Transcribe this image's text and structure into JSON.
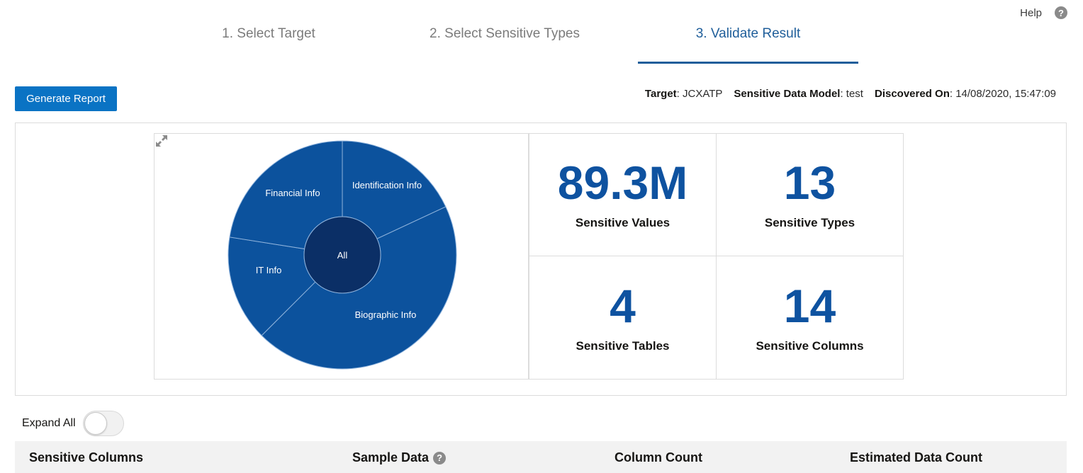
{
  "help": {
    "label": "Help",
    "icon": "help-icon"
  },
  "train": {
    "steps": [
      {
        "label": "1. Select Target",
        "active": false
      },
      {
        "label": "2. Select Sensitive Types",
        "active": false
      },
      {
        "label": "3. Validate Result",
        "active": true
      }
    ]
  },
  "toolbar": {
    "generate_report": "Generate Report"
  },
  "meta": {
    "target_label": "Target",
    "target_value": "JCXATP",
    "model_label": "Sensitive Data Model",
    "model_value": "test",
    "discovered_label": "Discovered On",
    "discovered_value": "14/08/2020, 15:47:09"
  },
  "sunburst": {
    "center_label": "All",
    "segments": [
      {
        "label": "Identification Info"
      },
      {
        "label": "Biographic Info"
      },
      {
        "label": "IT Info"
      },
      {
        "label": "Financial Info"
      }
    ],
    "colors": {
      "segment": "#0c529d",
      "center": "#0b2f66",
      "divider": "#8fb3dc"
    },
    "expand_icon": "expand-arrows-icon"
  },
  "metrics": [
    {
      "value": "89.3M",
      "label": "Sensitive Values"
    },
    {
      "value": "13",
      "label": "Sensitive Types"
    },
    {
      "value": "4",
      "label": "Sensitive Tables"
    },
    {
      "value": "14",
      "label": "Sensitive Columns"
    }
  ],
  "expand_all": {
    "label": "Expand All",
    "on": false
  },
  "table": {
    "columns": [
      {
        "label": "Sensitive Columns"
      },
      {
        "label": "Sample Data",
        "help": true
      },
      {
        "label": "Column Count"
      },
      {
        "label": "Estimated Data Count"
      }
    ]
  }
}
